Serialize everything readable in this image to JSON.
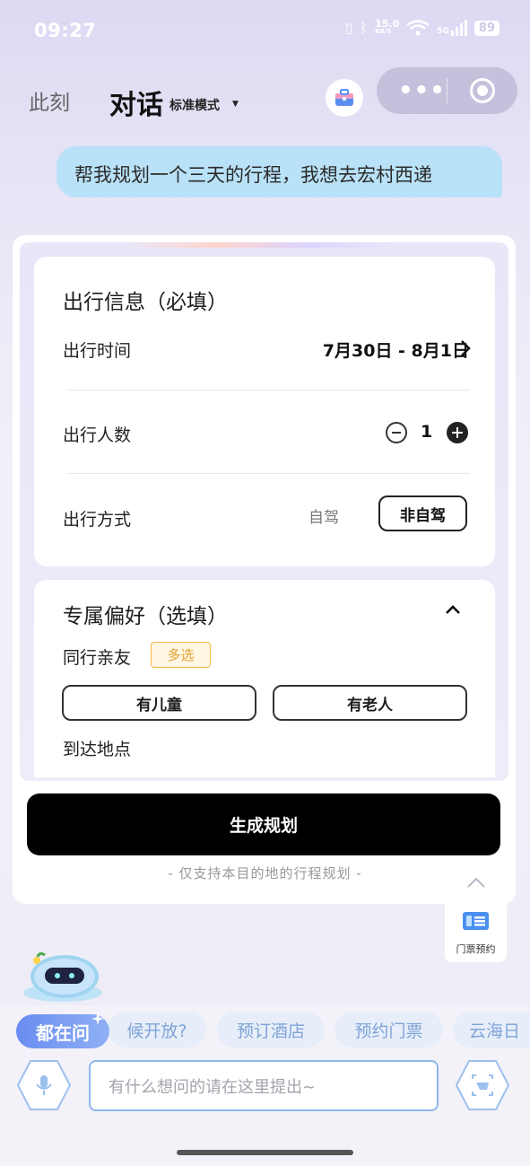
{
  "status_bar": {
    "time": "09:27",
    "net_speed": "15.0",
    "net_unit": "KB/S",
    "signal_label": "5G",
    "battery": "89"
  },
  "header": {
    "now_tab": "此刻",
    "chat_tab": "对话",
    "mode_label": "标准模式"
  },
  "user_message": "帮我规划一个三天的行程，我想去宏村西递",
  "travel_info": {
    "title": "出行信息（必填）",
    "time_label": "出行时间",
    "time_value": "7月30日 - 8月1日",
    "people_label": "出行人数",
    "people_count": "1",
    "mode_label": "出行方式",
    "mode_options": [
      "自驾",
      "非自驾"
    ],
    "mode_selected": "非自驾"
  },
  "preferences": {
    "title": "专属偏好（选填）",
    "companions_label": "同行亲友",
    "multi_badge": "多选",
    "companion_options": [
      "有儿童",
      "有老人"
    ],
    "arrival_label": "到达地点"
  },
  "generate_button": "生成规划",
  "generate_note": "- 仅支持本目的地的行程规划 -",
  "ticket_widget_label": "门票预约",
  "quick_chips": {
    "primary": "都在问",
    "items": [
      "候开放?",
      "预订酒店",
      "预约门票",
      "云海日"
    ]
  },
  "input_placeholder": "有什么想问的请在这里提出~",
  "colors": {
    "bubble": "#b9e1f7",
    "accent_blue": "#6a8cf0",
    "badge_orange": "#f0b94a"
  }
}
